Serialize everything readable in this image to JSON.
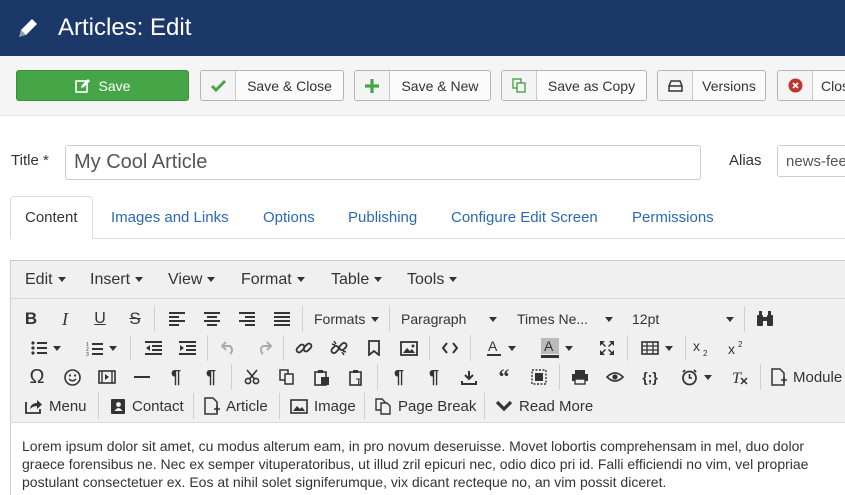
{
  "header": {
    "title": "Articles: Edit",
    "icon": "pencil-icon"
  },
  "toolbar": {
    "save": "Save",
    "save_close": "Save & Close",
    "save_new": "Save & New",
    "save_copy": "Save as Copy",
    "versions": "Versions",
    "close": "Close"
  },
  "form": {
    "title_label": "Title *",
    "title_value": "My Cool Article",
    "alias_label": "Alias",
    "alias_value": "news-feed"
  },
  "tabs": [
    "Content",
    "Images and Links",
    "Options",
    "Publishing",
    "Configure Edit Screen",
    "Permissions"
  ],
  "editor": {
    "menus": [
      "Edit",
      "Insert",
      "View",
      "Format",
      "Table",
      "Tools"
    ],
    "formats": "Formats",
    "block": "Paragraph",
    "font": "Times Ne...",
    "size": "12pt",
    "module": "Module",
    "buttons": {
      "menu": "Menu",
      "contact": "Contact",
      "article": "Article",
      "image": "Image",
      "pagebreak": "Page Break",
      "readmore": "Read More"
    },
    "content": "Lorem ipsum dolor sit amet, cu modus alterum eam, in pro novum deseruisse. Movet lobortis comprehensam in mel, duo dolor graece forensibus ne. Nec ex semper vituperatoribus, ut illud zril epicuri nec, odio dico pri id. Falli efficiendi no vim, vel propriae postulant consectetuer ex. Eos at nihil solet signiferumque, vix dicant recteque no, an vim possit diceret."
  },
  "colors": {
    "header_bg": "#1c3869",
    "save_bg": "#46a546",
    "link": "#2a69b8"
  }
}
